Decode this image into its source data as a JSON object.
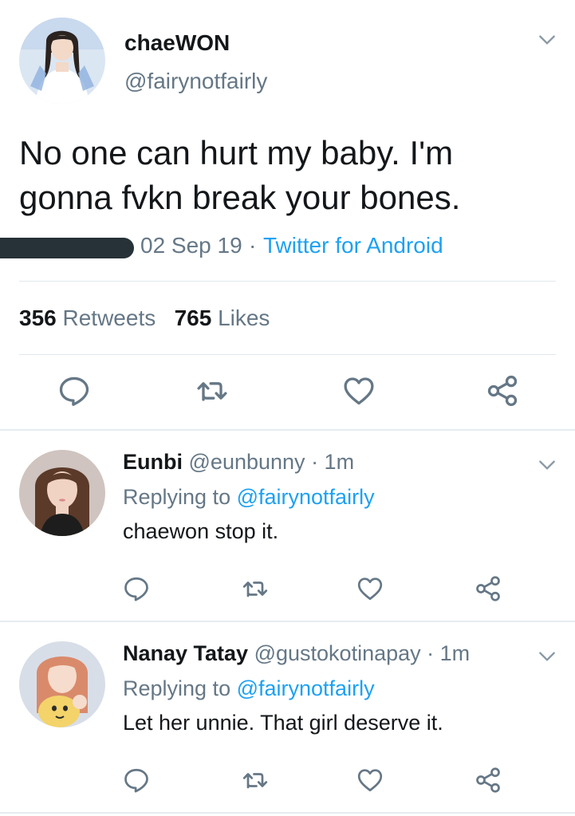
{
  "main_tweet": {
    "author_name": "chaeWON",
    "author_handle": "@fairynotfairly",
    "text_line1": "No one can hurt my baby. I'm",
    "text_line2": "gonna fvkn break your bones.",
    "date": "02 Sep 19",
    "separator": "·",
    "source": "Twitter for Android",
    "retweets_count": "356",
    "retweets_label": "Retweets",
    "likes_count": "765",
    "likes_label": "Likes"
  },
  "replies": [
    {
      "name": "Eunbi",
      "handle": "@eunbunny",
      "time": "· 1m",
      "replying_prefix": "Replying to",
      "replying_handle": "@fairynotfairly",
      "text": "chaewon stop it."
    },
    {
      "name": "Nanay Tatay",
      "handle": "@gustokotinapay",
      "time": "· 1m",
      "replying_prefix": "Replying to",
      "replying_handle": "@fairynotfairly",
      "text": "Let her unnie. That girl deserve it."
    }
  ],
  "colors": {
    "link": "#1da1f2",
    "secondary_text": "#657786",
    "primary_text": "#14171a",
    "divider": "#e1e8ed",
    "icon": "#657786"
  },
  "icons": [
    "chevron-down-icon",
    "reply-icon",
    "retweet-icon",
    "like-icon",
    "share-icon"
  ]
}
